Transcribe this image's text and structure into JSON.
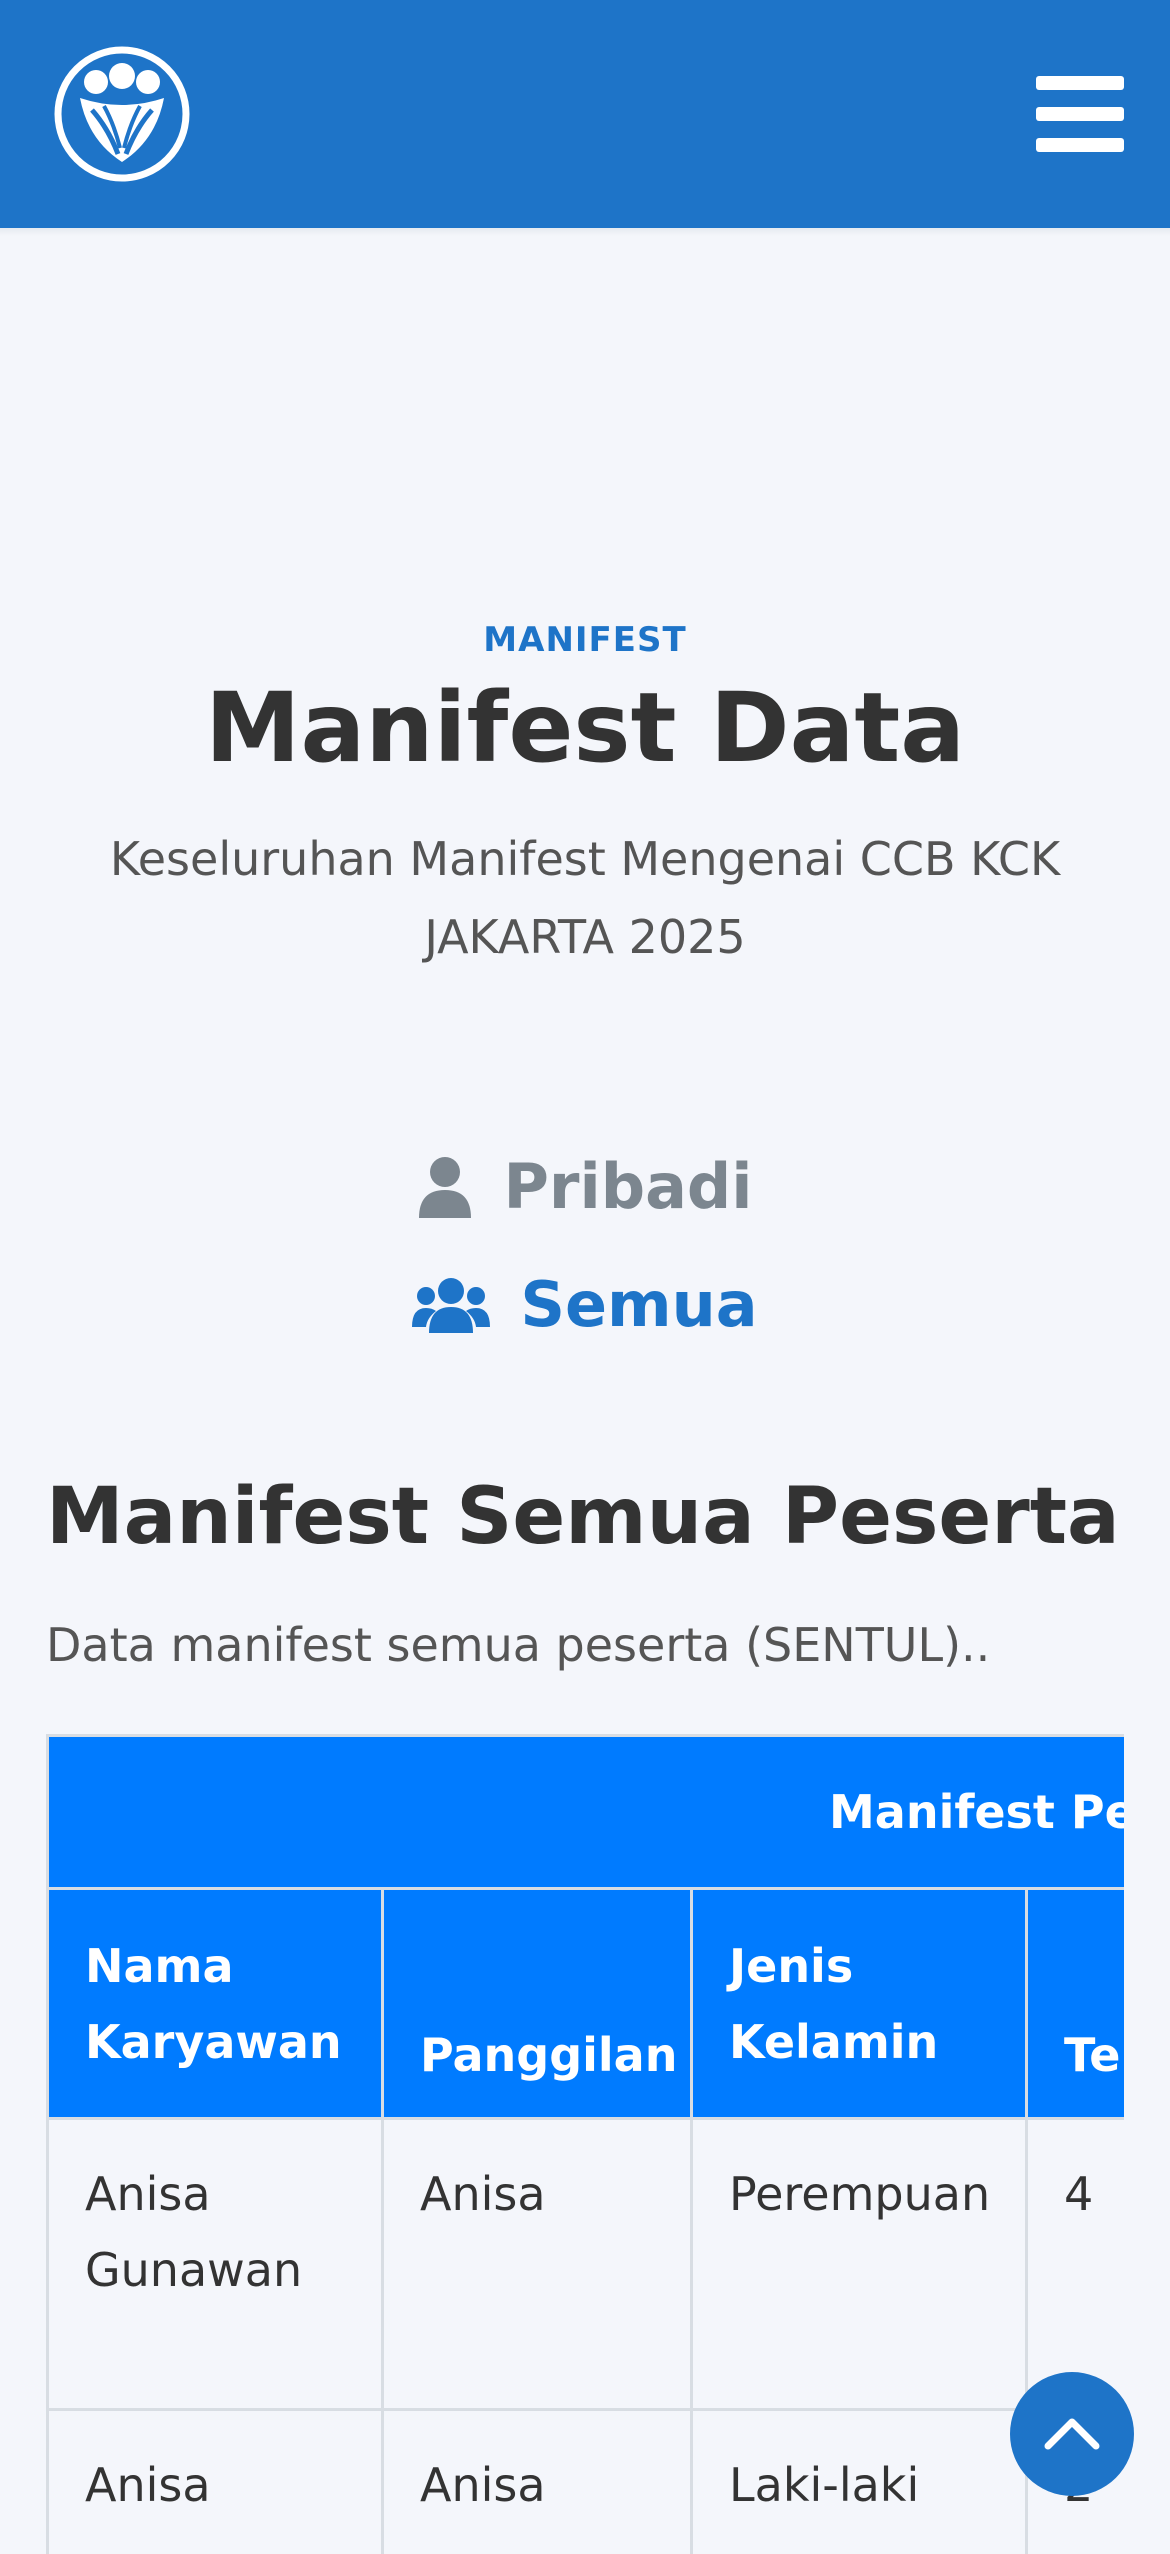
{
  "header": {
    "logo_icon": "community-logo-icon",
    "menu_icon": "hamburger-menu-icon",
    "bg_color": "#1e74c8"
  },
  "hero": {
    "section_label": "MANIFEST",
    "title": "Manifest Data",
    "subtitle": "Keseluruhan Manifest Mengenai CCB KCK JAKARTA 2025"
  },
  "toggle": {
    "pribadi": {
      "label": "Pribadi",
      "icon": "user-icon",
      "color": "#7c868f"
    },
    "semua": {
      "label": "Semua",
      "icon": "users-icon",
      "color": "#1e74c8"
    }
  },
  "section": {
    "heading": "Manifest Semua Peserta",
    "description": "Data manifest semua peserta (SENTUL).."
  },
  "table": {
    "caption": "Manifest Pes",
    "columns": [
      "Nama Karyawan",
      "Panggilan",
      "Jenis Kelamin",
      "Te"
    ],
    "rows": [
      [
        "Anisa Gunawan",
        "Anisa",
        "Perempuan",
        "4"
      ],
      [
        "Anisa",
        "Anisa",
        "Laki-laki",
        "2"
      ]
    ]
  },
  "scroll_top": {
    "icon": "chevron-up-icon"
  }
}
